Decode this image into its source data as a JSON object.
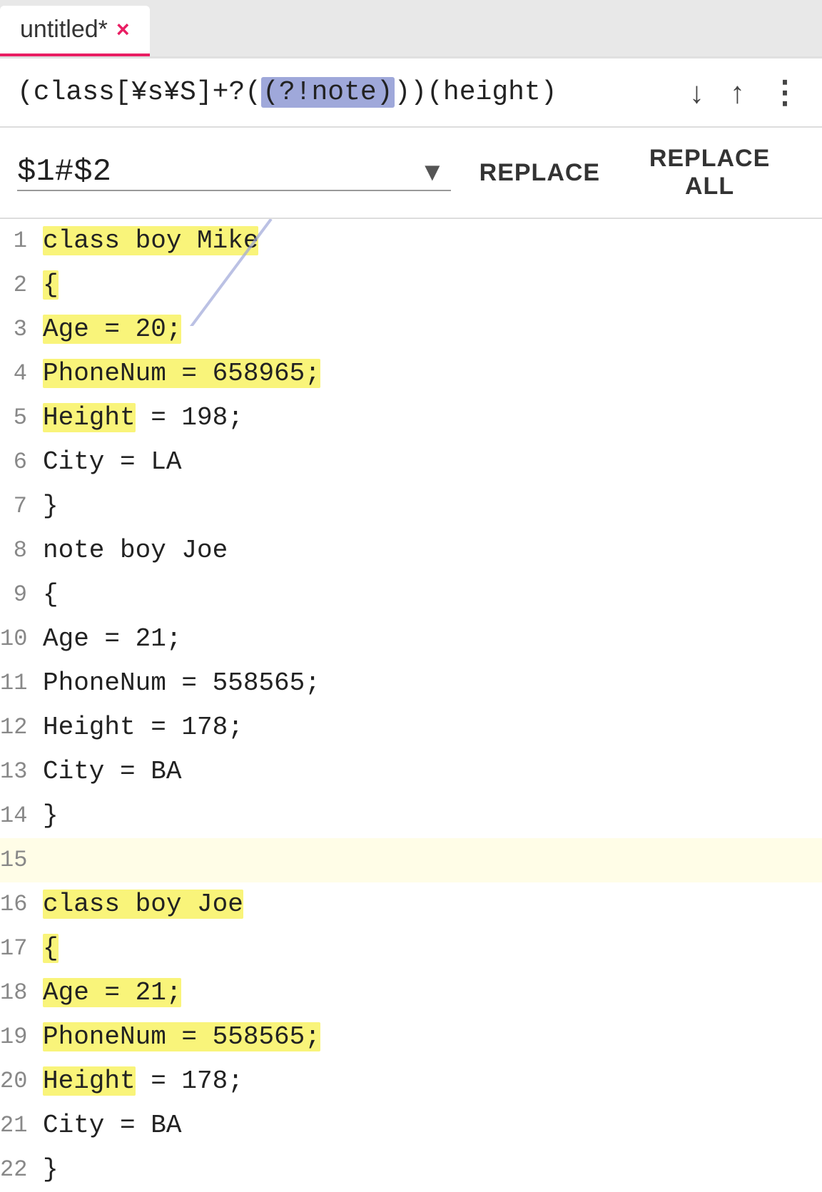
{
  "tab": {
    "title": "untitled*",
    "close_label": "×"
  },
  "search": {
    "pattern": "(class[¥s¥S]+?(",
    "pattern_highlight": "(?!note)",
    "pattern_end": "))(height)",
    "down_arrow": "↓",
    "up_arrow": "↑",
    "more_label": "⋮"
  },
  "replace": {
    "value": "$1#$2",
    "dropdown_arrow": "▼",
    "replace_label": "REPLACE",
    "replace_all_label": "REPLACE ALL"
  },
  "lines": [
    {
      "num": "1",
      "content": "class boy Mike",
      "hl_ranges": [
        [
          0,
          14
        ]
      ],
      "highlighted_line": false
    },
    {
      "num": "2",
      "content": "{",
      "hl_ranges": [
        [
          0,
          1
        ]
      ],
      "highlighted_line": false
    },
    {
      "num": "3",
      "content": "Age = 20;",
      "hl_ranges": [
        [
          0,
          9
        ]
      ],
      "highlighted_line": false
    },
    {
      "num": "4",
      "content": "PhoneNum = 658965;",
      "hl_ranges": [
        [
          0,
          18
        ]
      ],
      "highlighted_line": false
    },
    {
      "num": "5",
      "content": "Height = 198;",
      "hl_ranges": [
        [
          0,
          5
        ]
      ],
      "highlighted_line": false
    },
    {
      "num": "6",
      "content": "City = LA",
      "hl_ranges": [],
      "highlighted_line": false
    },
    {
      "num": "7",
      "content": "}",
      "hl_ranges": [],
      "highlighted_line": false
    },
    {
      "num": "8",
      "content": "note boy Joe",
      "hl_ranges": [],
      "highlighted_line": false
    },
    {
      "num": "9",
      "content": "{",
      "hl_ranges": [],
      "highlighted_line": false
    },
    {
      "num": "10",
      "content": "Age = 21;",
      "hl_ranges": [],
      "highlighted_line": false
    },
    {
      "num": "11",
      "content": "PhoneNum = 558565;",
      "hl_ranges": [],
      "highlighted_line": false
    },
    {
      "num": "12",
      "content": "Height = 178;",
      "hl_ranges": [],
      "highlighted_line": false
    },
    {
      "num": "13",
      "content": "City = BA",
      "hl_ranges": [],
      "highlighted_line": false
    },
    {
      "num": "14",
      "content": "}",
      "hl_ranges": [],
      "highlighted_line": false
    },
    {
      "num": "15",
      "content": "",
      "hl_ranges": [],
      "highlighted_line": true
    },
    {
      "num": "16",
      "content": "class boy Joe",
      "hl_ranges": [
        [
          0,
          13
        ]
      ],
      "highlighted_line": false
    },
    {
      "num": "17",
      "content": "{",
      "hl_ranges": [
        [
          0,
          1
        ]
      ],
      "highlighted_line": false
    },
    {
      "num": "18",
      "content": "Age = 21;",
      "hl_ranges": [
        [
          0,
          9
        ]
      ],
      "highlighted_line": false
    },
    {
      "num": "19",
      "content": "PhoneNum = 558565;",
      "hl_ranges": [
        [
          0,
          18
        ]
      ],
      "highlighted_line": false
    },
    {
      "num": "20",
      "content": "Height = 178;",
      "hl_ranges": [
        [
          0,
          6
        ]
      ],
      "highlighted_line": false
    },
    {
      "num": "21",
      "content": "City = BA",
      "hl_ranges": [],
      "highlighted_line": false
    },
    {
      "num": "22",
      "content": "}",
      "hl_ranges": [],
      "highlighted_line": false
    }
  ]
}
